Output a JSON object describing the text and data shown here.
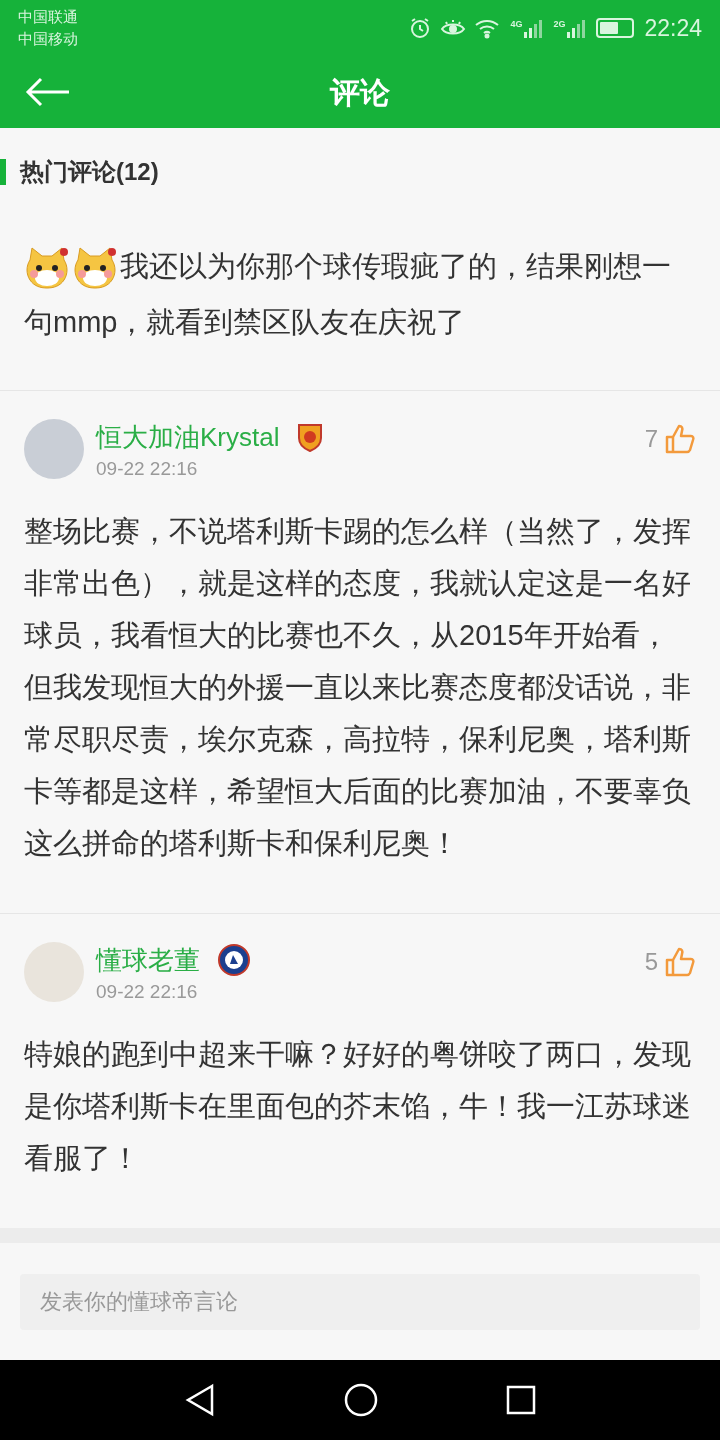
{
  "status_bar": {
    "carriers": [
      "中国联通",
      "中国移动"
    ],
    "network_labels": [
      "4G",
      "2G"
    ],
    "time": "22:24"
  },
  "header": {
    "title": "评论"
  },
  "section": {
    "title": "热门评论(12)"
  },
  "comments": [
    {
      "kind": "partial",
      "emojis": [
        {
          "kind": "dog"
        },
        {
          "kind": "dog"
        }
      ],
      "text": "我还以为你那个球传瑕疵了的，结果刚想一句mmp，就看到禁区队友在庆祝了"
    },
    {
      "kind": "full",
      "avatar": {
        "kind": "person"
      },
      "user": "恒大加油Krystal",
      "badge": {
        "kind": "shield"
      },
      "date": "09-22 22:16",
      "likes": "7",
      "text": "整场比赛，不说塔利斯卡踢的怎么样（当然了，发挥非常出色），就是这样的态度，我就认定这是一名好球员，我看恒大的比赛也不久，从2015年开始看，但我发现恒大的外援一直以来比赛态度都没话说，非常尽职尽责，埃尔克森，高拉特，保利尼奥，塔利斯卡等都是这样，希望恒大后面的比赛加油，不要辜负这么拼命的塔利斯卡和保利尼奥！"
    },
    {
      "kind": "full",
      "avatar": {
        "kind": "dog"
      },
      "user": "懂球老董",
      "badge": {
        "kind": "round"
      },
      "date": "09-22 22:16",
      "likes": "5",
      "text": "特娘的跑到中超来干嘛？好好的粤饼咬了两口，发现是你塔利斯卡在里面包的芥末馅，牛！我一江苏球迷看服了！"
    }
  ],
  "comment_input": {
    "placeholder": "发表你的懂球帝言论"
  }
}
